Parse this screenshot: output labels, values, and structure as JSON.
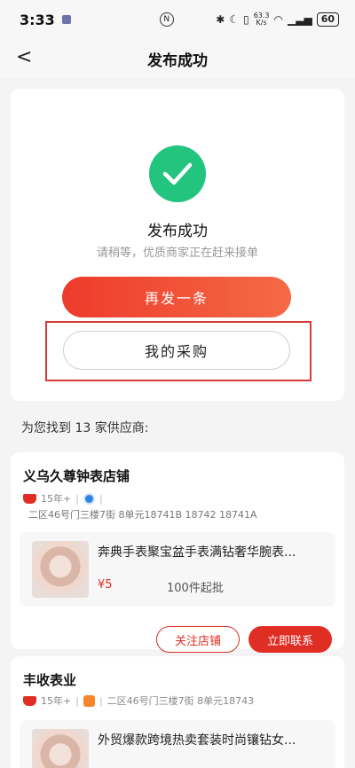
{
  "status": {
    "time": "3:33",
    "speed_value": "63.3",
    "speed_unit": "K/s",
    "battery": "60"
  },
  "nav": {
    "back": "<",
    "title": "发布成功"
  },
  "success": {
    "title": "发布成功",
    "subtitle": "请稍等，优质商家正在赶来接单",
    "repost_label": "再发一条",
    "my_purchase_label": "我的采购"
  },
  "found_text": "为您找到 13 家供应商:",
  "suppliers": [
    {
      "name": "义乌久尊钟表店铺",
      "years": "15年+",
      "address": "二区46号门三楼7街 8单元18741B 18742 18741A",
      "product": {
        "title": "奔典手表聚宝盆手表满钻奢华腕表...",
        "price": "¥5",
        "moq": "100件起批"
      },
      "follow_label": "关注店铺",
      "contact_label": "立即联系"
    },
    {
      "name": "丰收表业",
      "years": "15年+",
      "address": "二区46号门三楼7街 8单元18743",
      "product": {
        "title": "外贸爆款跨境热卖套装时尚镶钻女..."
      }
    }
  ],
  "colors": {
    "accent": "#e02e24",
    "success": "#22c47e"
  }
}
